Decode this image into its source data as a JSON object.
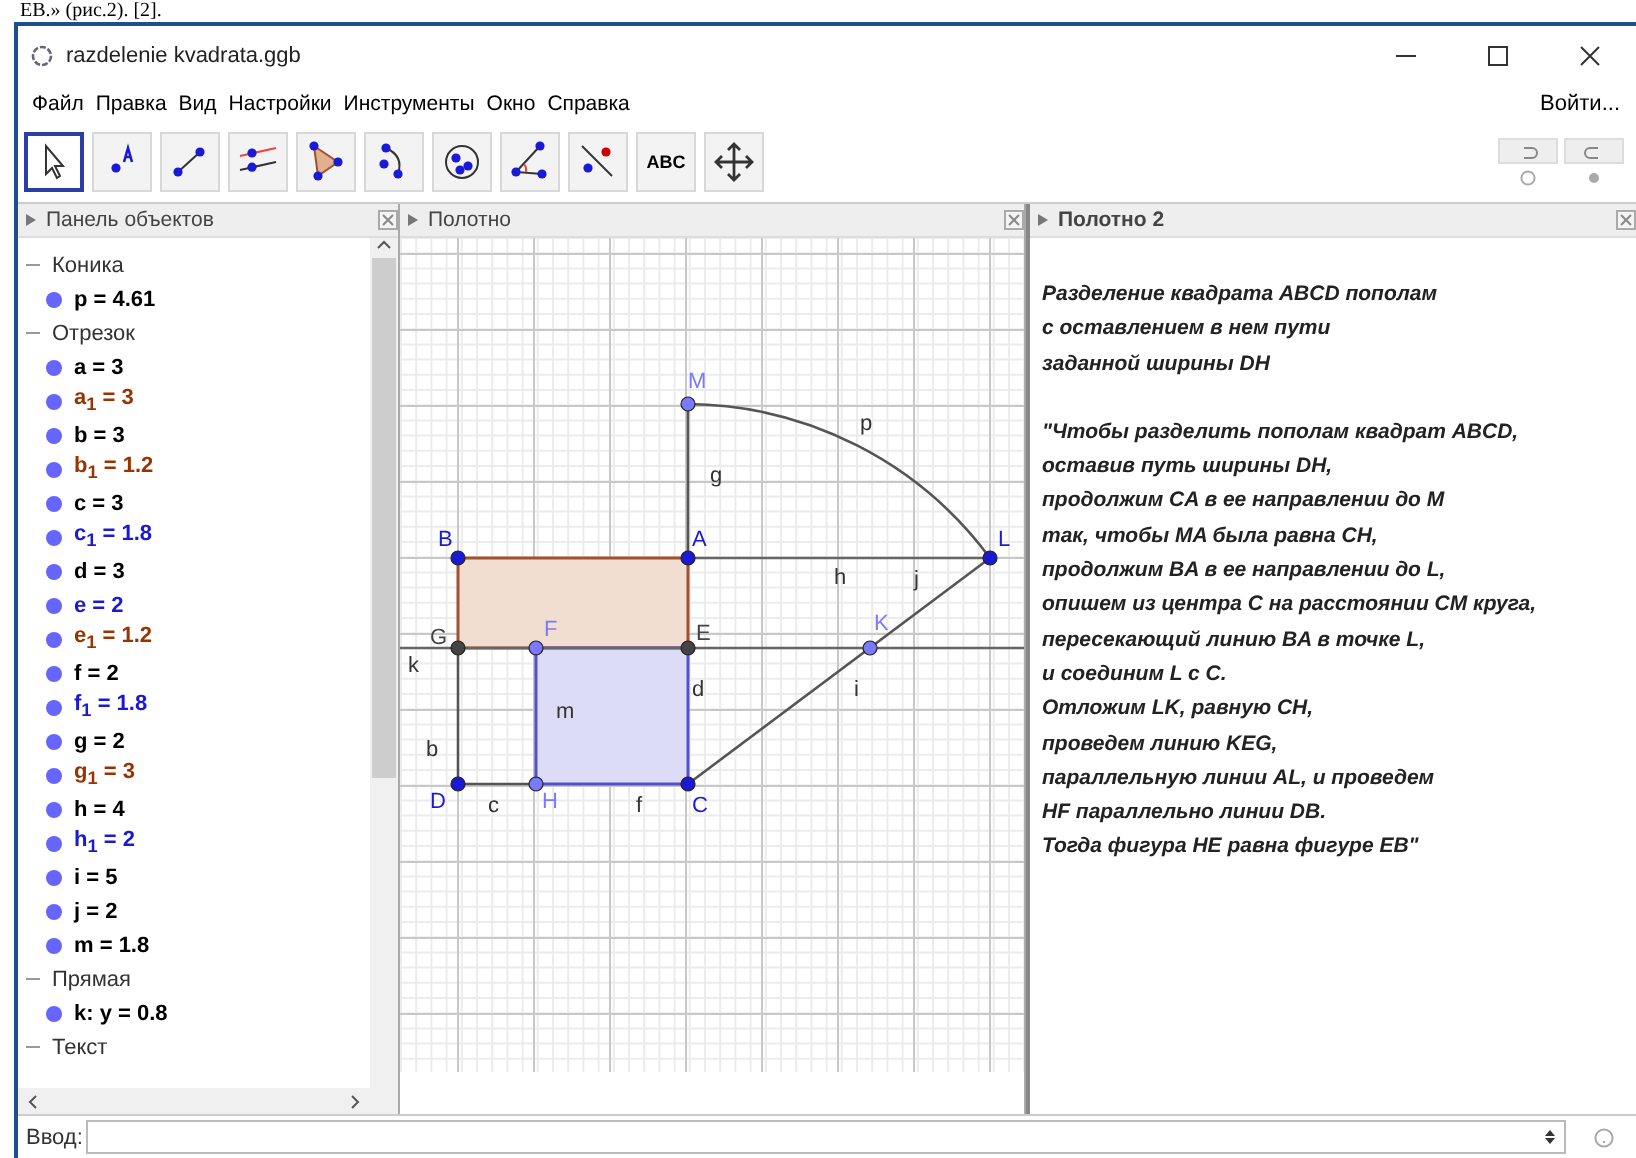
{
  "doc_fragment": "EB.» (рис.2). [2].",
  "window": {
    "title": "razdelenie kvadrata.ggb",
    "login": "Войти..."
  },
  "menu": [
    "Файл",
    "Правка",
    "Вид",
    "Настройки",
    "Инструменты",
    "Окно",
    "Справка"
  ],
  "toolbar": [
    {
      "kind": "pointer",
      "selected": true
    },
    {
      "kind": "point",
      "selected": false
    },
    {
      "kind": "segment",
      "selected": false
    },
    {
      "kind": "parallel",
      "selected": false
    },
    {
      "kind": "polygon",
      "selected": false
    },
    {
      "kind": "arc",
      "selected": false
    },
    {
      "kind": "circle",
      "selected": false
    },
    {
      "kind": "angle",
      "selected": false
    },
    {
      "kind": "reflect",
      "selected": false
    },
    {
      "kind": "text",
      "selected": false,
      "label": "ABC"
    },
    {
      "kind": "move",
      "selected": false
    }
  ],
  "algebra": {
    "title": "Панель объектов",
    "groups": [
      {
        "label": "Коника",
        "expanded": true,
        "children": [
          {
            "text": "p = 4.61",
            "color": "#000000"
          }
        ]
      },
      {
        "label": "Отрезок",
        "expanded": true,
        "children": [
          {
            "text": "a = 3",
            "color": "#000000"
          },
          {
            "text": "a$_{1}$ = 3",
            "color": "#993300"
          },
          {
            "text": "b = 3",
            "color": "#000000"
          },
          {
            "text": "b$_{1}$ = 1.2",
            "color": "#993300"
          },
          {
            "text": "c = 3",
            "color": "#000000"
          },
          {
            "text": "c$_{1}$ = 1.8",
            "color": "#1a1ad6"
          },
          {
            "text": "d = 3",
            "color": "#000000"
          },
          {
            "text": "e = 2",
            "color": "#1a1ad6"
          },
          {
            "text": "e$_{1}$ = 1.2",
            "color": "#993300"
          },
          {
            "text": "f = 2",
            "color": "#000000"
          },
          {
            "text": "f$_{1}$ = 1.8",
            "color": "#1a1ad6"
          },
          {
            "text": "g = 2",
            "color": "#000000"
          },
          {
            "text": "g$_{1}$ = 3",
            "color": "#993300"
          },
          {
            "text": "h = 4",
            "color": "#000000"
          },
          {
            "text": "h$_{1}$ = 2",
            "color": "#1a1ad6"
          },
          {
            "text": "i = 5",
            "color": "#000000"
          },
          {
            "text": "j = 2",
            "color": "#000000"
          },
          {
            "text": "m = 1.8",
            "color": "#000000"
          }
        ]
      },
      {
        "label": "Прямая",
        "expanded": true,
        "children": [
          {
            "text": "k: y = 0.8",
            "color": "#000000"
          }
        ]
      },
      {
        "label": "Текст",
        "expanded": true
      }
    ]
  },
  "canvas": {
    "title": "Полотно",
    "points": [
      {
        "label": "M",
        "color": "#7a7aff"
      },
      {
        "label": "B",
        "color": "#1a1ad6"
      },
      {
        "label": "A",
        "color": "#1a1ad6"
      },
      {
        "label": "L",
        "color": "#1a1ad6"
      },
      {
        "label": "G",
        "color": "#444444"
      },
      {
        "label": "F",
        "color": "#7a7aff"
      },
      {
        "label": "E",
        "color": "#444444"
      },
      {
        "label": "K",
        "color": "#7a7aff"
      },
      {
        "label": "D",
        "color": "#1a1ad6"
      },
      {
        "label": "H",
        "color": "#7a7aff"
      },
      {
        "label": "C",
        "color": "#1a1ad6"
      }
    ],
    "object_labels": [
      "p",
      "g",
      "h",
      "j",
      "k",
      "i",
      "d",
      "m",
      "b",
      "c",
      "f"
    ]
  },
  "graphics2": {
    "title": "Полотно 2",
    "paragraphs": [
      [
        "Разделение квадрата ABCD пополам",
        "с оставлением в нем пути",
        "заданной ширины DH"
      ],
      [
        "\"Чтобы разделить пополам квадрат ABCD,",
        "оставив путь ширины  DH,",
        "продолжим  CA в ее направлении до  M",
        "так, чтобы MA была равна  CH,",
        "продолжим  BA в ее направлении до L,",
        "опишем из центра C на расстоянии  CM круга,",
        "пересекающий линию BA в точке L,",
        "и соединим L с C.",
        "Отложим LK, равную CH,",
        "проведем линию KEG,",
        "параллельную линии AL, и проведем",
        "HF параллельно линии DB.",
        "Тогда фигура HE равна фигуре EB\""
      ]
    ]
  },
  "input": {
    "label": "Ввод:"
  }
}
